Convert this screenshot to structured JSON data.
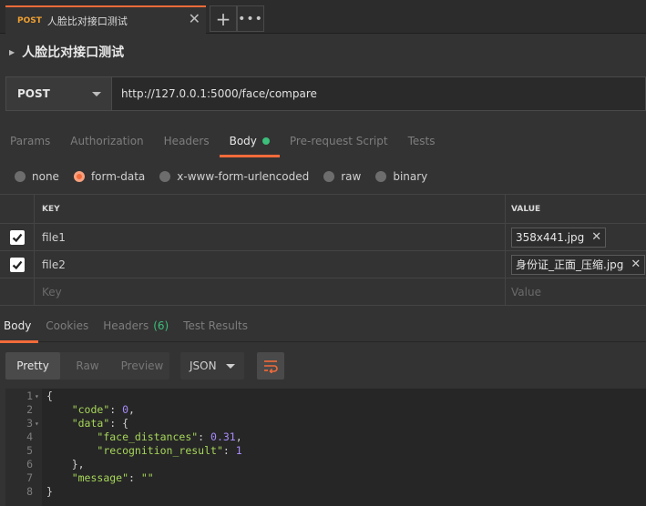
{
  "tab": {
    "method": "POST",
    "name": "人脸比对接口测试",
    "close": "✕"
  },
  "tab_controls": {
    "plus": "+",
    "more": "•••"
  },
  "request": {
    "title": "人脸比对接口测试",
    "method": "POST",
    "url": "http://127.0.0.1:5000/face/compare"
  },
  "request_tabs": [
    {
      "label": "Params"
    },
    {
      "label": "Authorization"
    },
    {
      "label": "Headers"
    },
    {
      "label": "Body",
      "active": true
    },
    {
      "label": "Pre-request Script"
    },
    {
      "label": "Tests"
    }
  ],
  "body_types": [
    {
      "label": "none"
    },
    {
      "label": "form-data",
      "selected": true
    },
    {
      "label": "x-www-form-urlencoded"
    },
    {
      "label": "raw"
    },
    {
      "label": "binary"
    }
  ],
  "form": {
    "key_header": "KEY",
    "value_header": "VALUE",
    "rows": [
      {
        "key": "file1",
        "value": "358x441.jpg",
        "checked": true
      },
      {
        "key": "file2",
        "value": "身份证_正面_压缩.jpg",
        "checked": true
      }
    ],
    "key_placeholder": "Key",
    "value_placeholder": "Value"
  },
  "response_tabs": [
    {
      "label": "Body",
      "active": true
    },
    {
      "label": "Cookies"
    },
    {
      "label": "Headers",
      "count": "(6)"
    },
    {
      "label": "Test Results"
    }
  ],
  "view_modes": [
    {
      "label": "Pretty",
      "active": true
    },
    {
      "label": "Raw"
    },
    {
      "label": "Preview"
    }
  ],
  "format": "JSON",
  "response_lines": [
    {
      "num": "1",
      "fold": true,
      "text": "{"
    },
    {
      "num": "2",
      "text": "    \"code\": 0,"
    },
    {
      "num": "3",
      "fold": true,
      "text": "    \"data\": {"
    },
    {
      "num": "4",
      "text": "        \"face_distances\": 0.31,"
    },
    {
      "num": "5",
      "text": "        \"recognition_result\": 1"
    },
    {
      "num": "6",
      "text": "    },"
    },
    {
      "num": "7",
      "text": "    \"message\": \"\""
    },
    {
      "num": "8",
      "text": "}"
    }
  ],
  "colors": {
    "accent": "#f26b3a",
    "success": "#3bbf7a",
    "method_orange": "#f0a030"
  }
}
